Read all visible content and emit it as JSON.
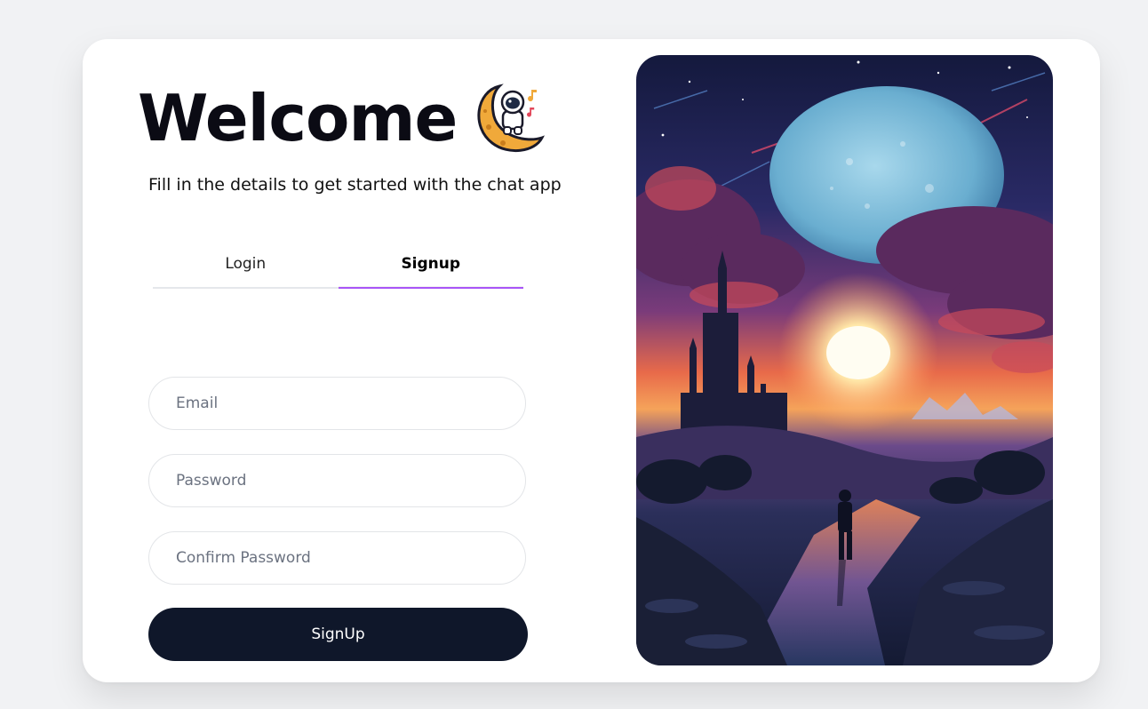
{
  "header": {
    "title": "Welcome",
    "mascot_icon": "astronaut-on-moon-icon",
    "subtitle": "Fill in the details to get started with the chat app"
  },
  "tabs": [
    {
      "label": "Login",
      "active": false
    },
    {
      "label": "Signup",
      "active": true
    }
  ],
  "form": {
    "email_placeholder": "Email",
    "password_placeholder": "Password",
    "confirm_placeholder": "Confirm Password",
    "submit_label": "SignUp"
  },
  "colors": {
    "accent": "#a855f7",
    "button": "#0f172a",
    "background": "#f1f2f4"
  }
}
